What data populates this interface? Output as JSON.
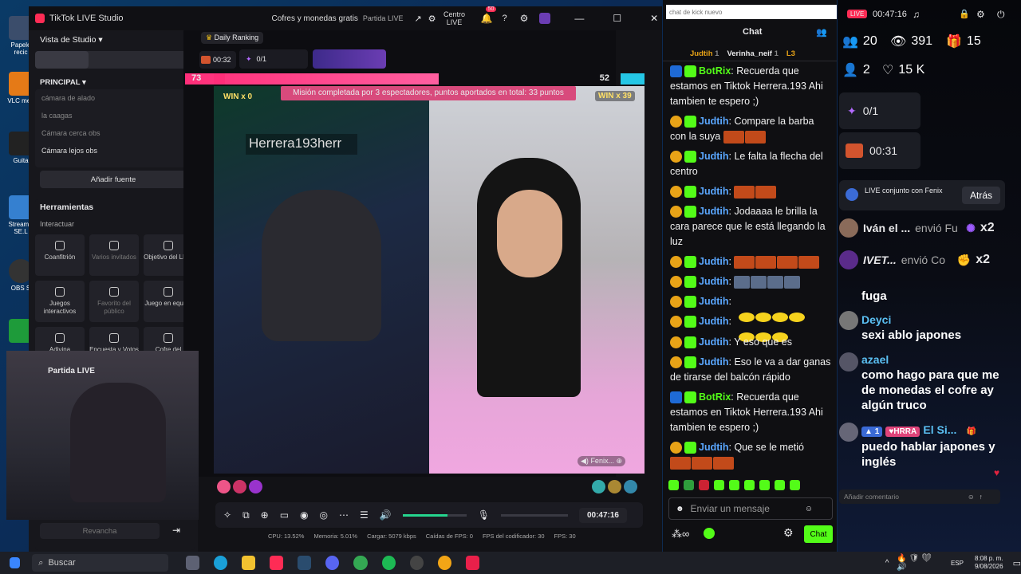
{
  "window": {
    "app_title": "TikTok LIVE Studio",
    "center_title": "Cofres y monedas gratis",
    "center_sub": "Partida LIVE",
    "centro_label": "Centro LIVE",
    "notif_count": "50"
  },
  "left": {
    "studio_view": "Vista de Studio",
    "principal": "PRINCIPAL",
    "sources": [
      "cámara de alado",
      "la caagas",
      "Cámara cerca obs",
      "Cámara lejos obs"
    ],
    "add_source": "Añadir fuente",
    "tools_title": "Herramientas",
    "interact": "Interactuar",
    "tools": [
      "Coanfitrión",
      "Varios invitados",
      "Objetivo del LIVE",
      "Juegos interactivos",
      "Favorito del público",
      "Juego en equipo",
      "Adivina",
      "Encuesta y Votos con",
      "Cofre del"
    ],
    "partida": "Partida LIVE",
    "revancha": "Revancha"
  },
  "stage": {
    "daily_ranking": "Daily Ranking",
    "timer": "00:32",
    "goal": "0/1",
    "score_left": "73",
    "score_right": "52",
    "mission": "Misión completada por 3 espectadores, puntos aportados en total: 33 puntos",
    "win_left": "WIN x 0",
    "win_right": "WIN x 39",
    "overlay_name": "Herrera193herr",
    "fenix": "Fenix...",
    "live_time": "00:47:16",
    "status": {
      "cpu": "CPU: 13.52%",
      "mem": "Memoria: 5.01%",
      "load": "Cargar: 5079 kbps",
      "drops": "Caídas de FPS: 0",
      "enc": "FPS del codificador: 30",
      "fps": "FPS: 30"
    }
  },
  "chat": {
    "search_placeholder": "chat de kick nuevo",
    "title": "Chat",
    "pinned": [
      {
        "name": "Judtih",
        "n": "1"
      },
      {
        "name": "Verinha_neif",
        "n": "1"
      },
      {
        "name": "L3",
        "n": ""
      }
    ],
    "messages": [
      {
        "user": "BotRix",
        "text": "Recuerda que estamos en Tiktok Herrera.193 Ahi tambien te espero ;)"
      },
      {
        "user": "Judtih",
        "text": "Compare la barba con la suya"
      },
      {
        "user": "Judtih",
        "text": "Le falta la flecha del centro"
      },
      {
        "user": "Judtih",
        "text": ""
      },
      {
        "user": "Judtih",
        "text": "Jodaaaa le brilla la cara parece que le está llegando la luz"
      },
      {
        "user": "Judtih",
        "text": ""
      },
      {
        "user": "Judtih",
        "text": ""
      },
      {
        "user": "Judtih",
        "text": ""
      },
      {
        "user": "Judtih",
        "text": ""
      },
      {
        "user": "Judtih",
        "text": "Y eso que es"
      },
      {
        "user": "Judtih",
        "text": "Eso le va a dar ganas de tirarse del balcón rápido"
      },
      {
        "user": "BotRix",
        "text": "Recuerda que estamos en Tiktok Herrera.193 Ahi tambien te espero ;)"
      },
      {
        "user": "Judtih",
        "text": "Que se le metió"
      }
    ],
    "input_placeholder": "Enviar un mensaje",
    "send_label": "Chat"
  },
  "tiktok": {
    "live_badge": "LIVE",
    "time": "00:47:16",
    "viewers": "20",
    "views": "391",
    "gifts": "15",
    "followers": "2",
    "likes": "15 K",
    "goal": "0/1",
    "timer": "00:31",
    "joint": "LIVE conjunto con Fenix",
    "back": "Atrás",
    "gift_rows": [
      {
        "name": "Iván el ...",
        "action": "envió Fu",
        "count": "x2"
      },
      {
        "name": "IVET...",
        "action": "envió Co",
        "count": "x2"
      }
    ],
    "comments": [
      {
        "name": "",
        "text": "fuga"
      },
      {
        "name": "Deyci",
        "text": "sexi ablo japones"
      },
      {
        "name": "azael",
        "text": "como hago para que me de monedas el cofre ay algún truco"
      },
      {
        "name": "El Si...",
        "text": "puedo hablar japones y inglés"
      }
    ],
    "level": "1",
    "fan_tag": "HRRA",
    "comment_placeholder": "Añadir comentario"
  },
  "taskbar": {
    "search": "Buscar",
    "lang": "ESP",
    "clock_time": "8:08 p. m.",
    "clock_date": "9/08/2026"
  }
}
